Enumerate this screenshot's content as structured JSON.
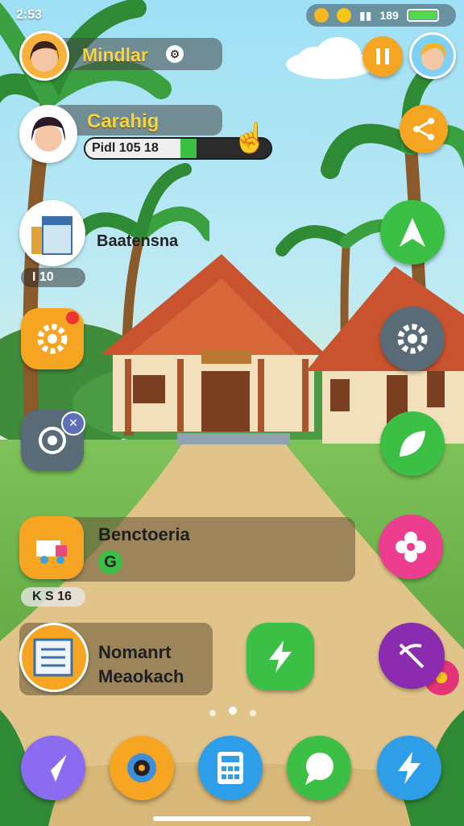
{
  "status_bar": {
    "time": "2:53",
    "signal_text": "189"
  },
  "profile": {
    "name": "Mindlar"
  },
  "quest": {
    "name": "Carahig",
    "progress_label": "Pidl 105 18",
    "progress_fraction": 0.6
  },
  "building_card": {
    "name": "Baatensna",
    "counter": "I 10"
  },
  "collection_card": {
    "name": "Benctoeria",
    "counter": "K S 16"
  },
  "news_card": {
    "line1": "Nomanrt",
    "line2": "Meaokach"
  },
  "icons": {
    "pause": "pause-icon",
    "share": "share-icon",
    "map": "map-icon",
    "settings": "gear-icon",
    "leaf": "leaf-icon",
    "flower": "flower-icon",
    "target": "target-icon",
    "bolt": "bolt-icon",
    "broom": "broom-icon",
    "send": "send-icon",
    "camera": "camera-icon",
    "calculator": "calculator-icon",
    "chat": "chat-icon",
    "dock_bolt": "bolt-icon"
  },
  "colors": {
    "accent_green": "#3cbf45",
    "accent_orange": "#f5a521",
    "accent_pink": "#ec3d8e",
    "accent_purple": "#8a2bb0"
  },
  "page_dots": 3
}
